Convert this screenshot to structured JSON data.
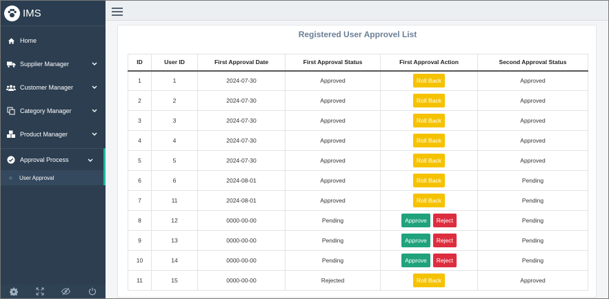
{
  "brand": {
    "name": "IMS"
  },
  "nav": {
    "home": "Home",
    "supplier": "Supplier Manager",
    "customer": "Customer Manager",
    "category": "Category Manager",
    "product": "Product Manager",
    "approval": "Approval Process",
    "user_approval": "User Approval"
  },
  "page": {
    "title": "Registered User Approvel List"
  },
  "table": {
    "headers": [
      "ID",
      "User ID",
      "First Approval Date",
      "First Approval Status",
      "First Approval Action",
      "Second Approval Status"
    ],
    "rows": [
      {
        "id": "1",
        "user_id": "1",
        "date": "2024-07-30",
        "status": "Approved",
        "action": "rollback",
        "second": "Approved"
      },
      {
        "id": "2",
        "user_id": "2",
        "date": "2024-07-30",
        "status": "Approved",
        "action": "rollback",
        "second": "Approved"
      },
      {
        "id": "3",
        "user_id": "3",
        "date": "2024-07-30",
        "status": "Approved",
        "action": "rollback",
        "second": "Approved"
      },
      {
        "id": "4",
        "user_id": "4",
        "date": "2024-07-30",
        "status": "Approved",
        "action": "rollback",
        "second": "Approved"
      },
      {
        "id": "5",
        "user_id": "5",
        "date": "2024-07-30",
        "status": "Approved",
        "action": "rollback",
        "second": "Approved"
      },
      {
        "id": "6",
        "user_id": "6",
        "date": "2024-08-01",
        "status": "Approved",
        "action": "rollback",
        "second": "Pending"
      },
      {
        "id": "7",
        "user_id": "11",
        "date": "2024-08-01",
        "status": "Approved",
        "action": "rollback",
        "second": "Pending"
      },
      {
        "id": "8",
        "user_id": "12",
        "date": "0000-00-00",
        "status": "Pending",
        "action": "approve_reject",
        "second": "Pending"
      },
      {
        "id": "9",
        "user_id": "13",
        "date": "0000-00-00",
        "status": "Pending",
        "action": "approve_reject",
        "second": "Pending"
      },
      {
        "id": "10",
        "user_id": "14",
        "date": "0000-00-00",
        "status": "Pending",
        "action": "approve_reject",
        "second": "Pending"
      },
      {
        "id": "11",
        "user_id": "15",
        "date": "0000-00-00",
        "status": "Rejected",
        "action": "rollback",
        "second": "Approved"
      }
    ]
  },
  "buttons": {
    "rollback": "Roll Back",
    "approve": "Approve",
    "reject": "Reject"
  },
  "icons": {
    "brand": "paw-icon",
    "home": "home-icon",
    "supplier": "truck-icon",
    "customer": "users-icon",
    "category": "copy-icon",
    "product": "cubes-icon",
    "approval": "check-circle-icon",
    "footer": [
      "settings-icon",
      "fullscreen-icon",
      "eye-slash-icon",
      "power-icon"
    ]
  },
  "colors": {
    "sidebar": "#2c3e50",
    "accent": "#1abc9c",
    "rollback": "#f5c200",
    "approve": "#20a37c",
    "reject": "#dd2e3f",
    "title": "#6b7f96"
  }
}
